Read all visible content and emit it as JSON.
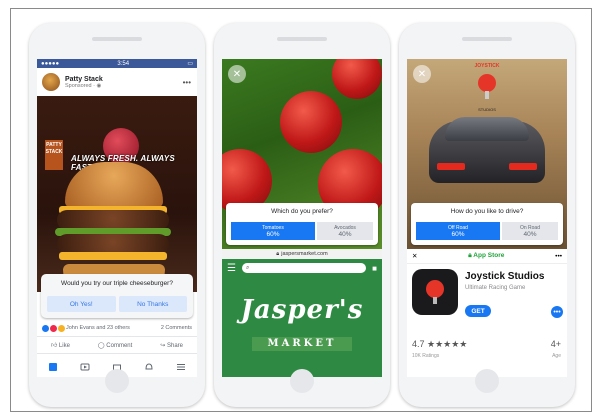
{
  "phone1": {
    "status_time": "3:54",
    "status_carrier": "●●●●● ",
    "page_name": "Patty Stack",
    "sponsored": "Sponsored · ",
    "brand_badge": "PATTY STACK",
    "tagline": "ALWAYS FRESH. ALWAYS FAST.",
    "poll_question": "Would you try our triple cheeseburger?",
    "option_a": "Oh Yes!",
    "option_b": "No Thanks",
    "reactions_text": "John Evans and 23 others",
    "comments_text": "2 Comments",
    "like": "Like",
    "comment": "Comment",
    "share": "Share"
  },
  "phone2": {
    "poll_question": "Which do you prefer?",
    "option_a": "Tomatoes",
    "option_a_pct": "60%",
    "option_b": "Avocados",
    "option_b_pct": "40%",
    "url": "jaspersmarket.com",
    "brand": "Jasper's",
    "brand_sub": "MARKET"
  },
  "phone3": {
    "poll_question": "How do you like to drive?",
    "option_a": "Off Road",
    "option_a_pct": "60%",
    "option_b": "On Road",
    "option_b_pct": "40%",
    "logo_text": "JOYSTICK",
    "logo_sub": "STUDIOS",
    "appstore_title": "App Store",
    "app_name": "Joystick Studios",
    "app_subtitle": "Ultimate Racing Game",
    "get": "GET",
    "rating": "4.7 ★★★★★",
    "age": "4+",
    "ratings_count": "10K Ratings",
    "age_label": "Age"
  },
  "colors": {
    "facebook_blue": "#1877f2",
    "market_green": "#2e8a42",
    "appstore_green": "#1fa33a"
  }
}
